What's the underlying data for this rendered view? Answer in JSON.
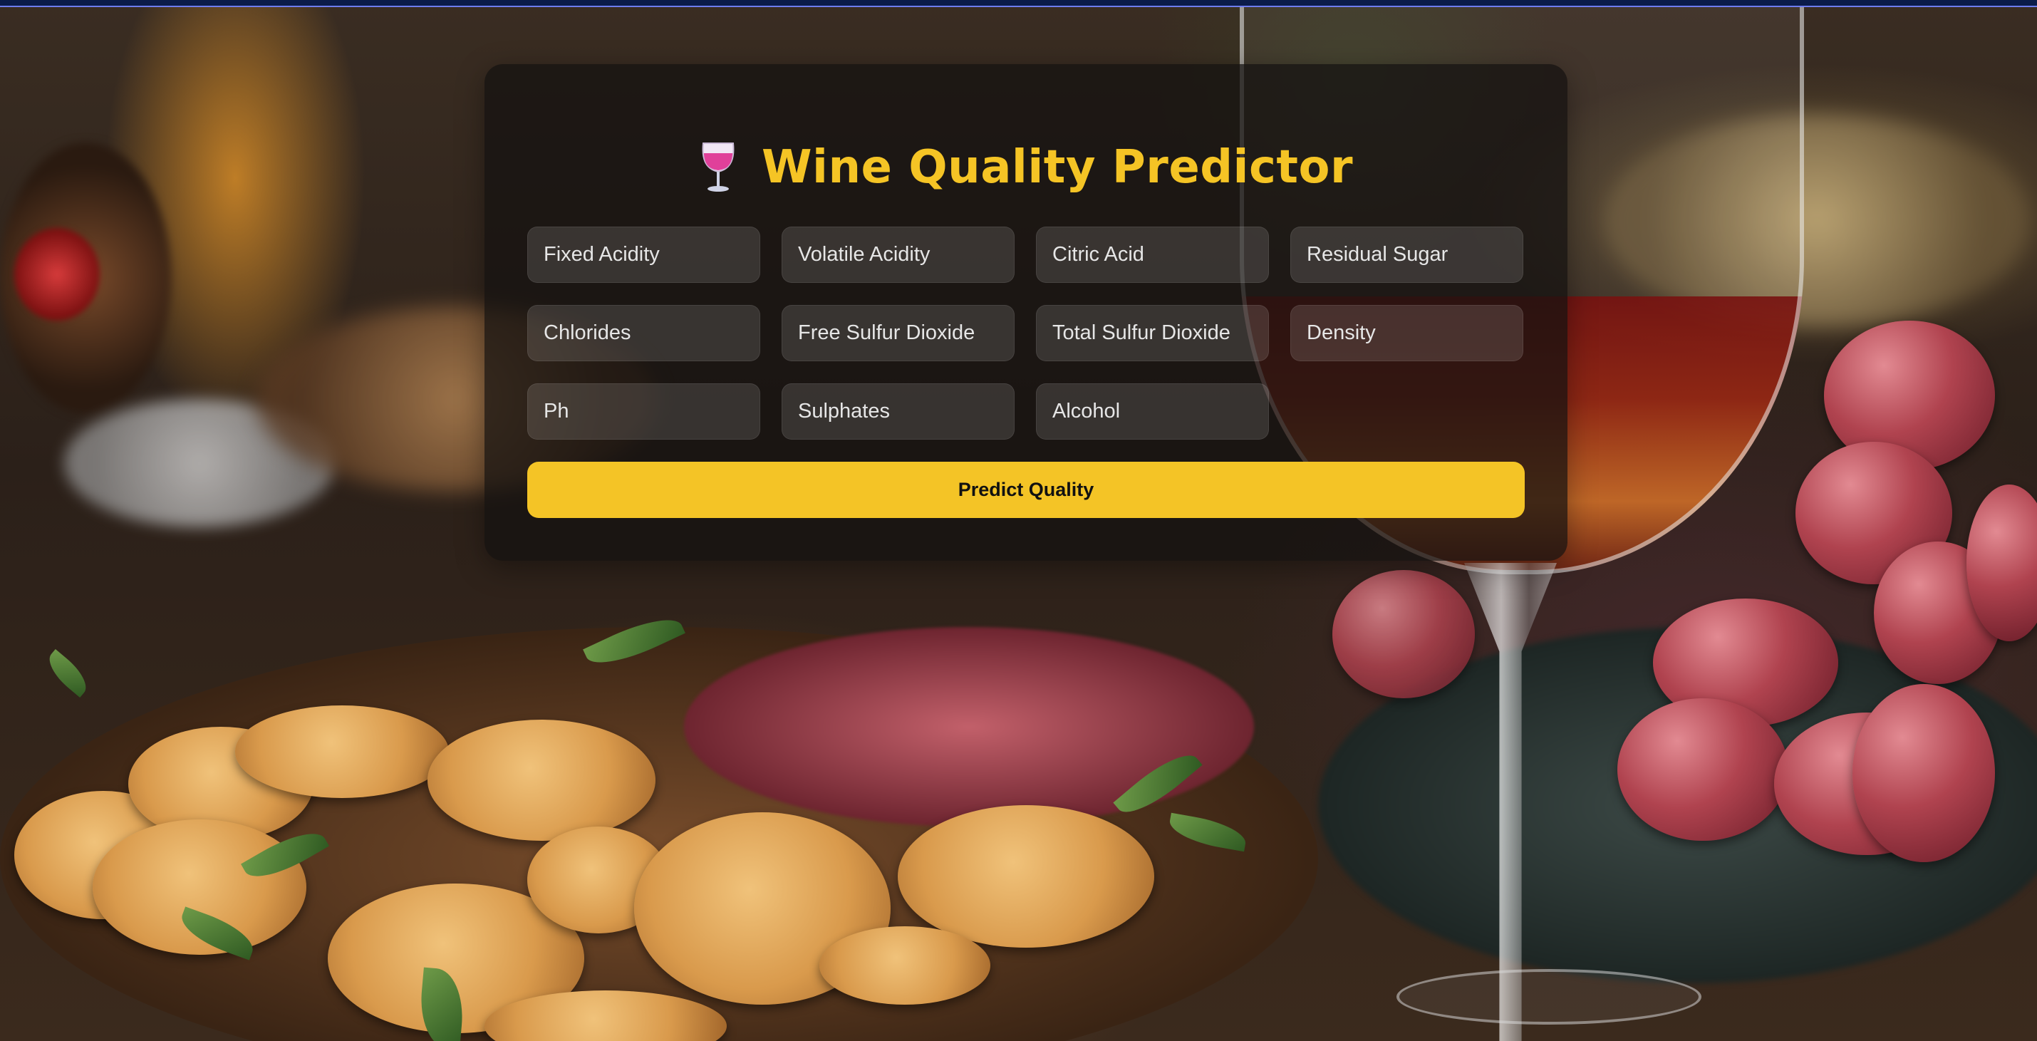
{
  "app": {
    "title": "Wine Quality Predictor",
    "title_icon": "wine-glass-icon",
    "accent_color": "#f4c426"
  },
  "form": {
    "fields": [
      {
        "placeholder": "Fixed Acidity",
        "value": ""
      },
      {
        "placeholder": "Volatile Acidity",
        "value": ""
      },
      {
        "placeholder": "Citric Acid",
        "value": ""
      },
      {
        "placeholder": "Residual Sugar",
        "value": ""
      },
      {
        "placeholder": "Chlorides",
        "value": ""
      },
      {
        "placeholder": "Free Sulfur Dioxide",
        "value": ""
      },
      {
        "placeholder": "Total Sulfur Dioxide",
        "value": ""
      },
      {
        "placeholder": "Density",
        "value": ""
      },
      {
        "placeholder": "Ph",
        "value": ""
      },
      {
        "placeholder": "Sulphates",
        "value": ""
      },
      {
        "placeholder": "Alcohol",
        "value": ""
      }
    ],
    "submit_label": "Predict Quality"
  }
}
